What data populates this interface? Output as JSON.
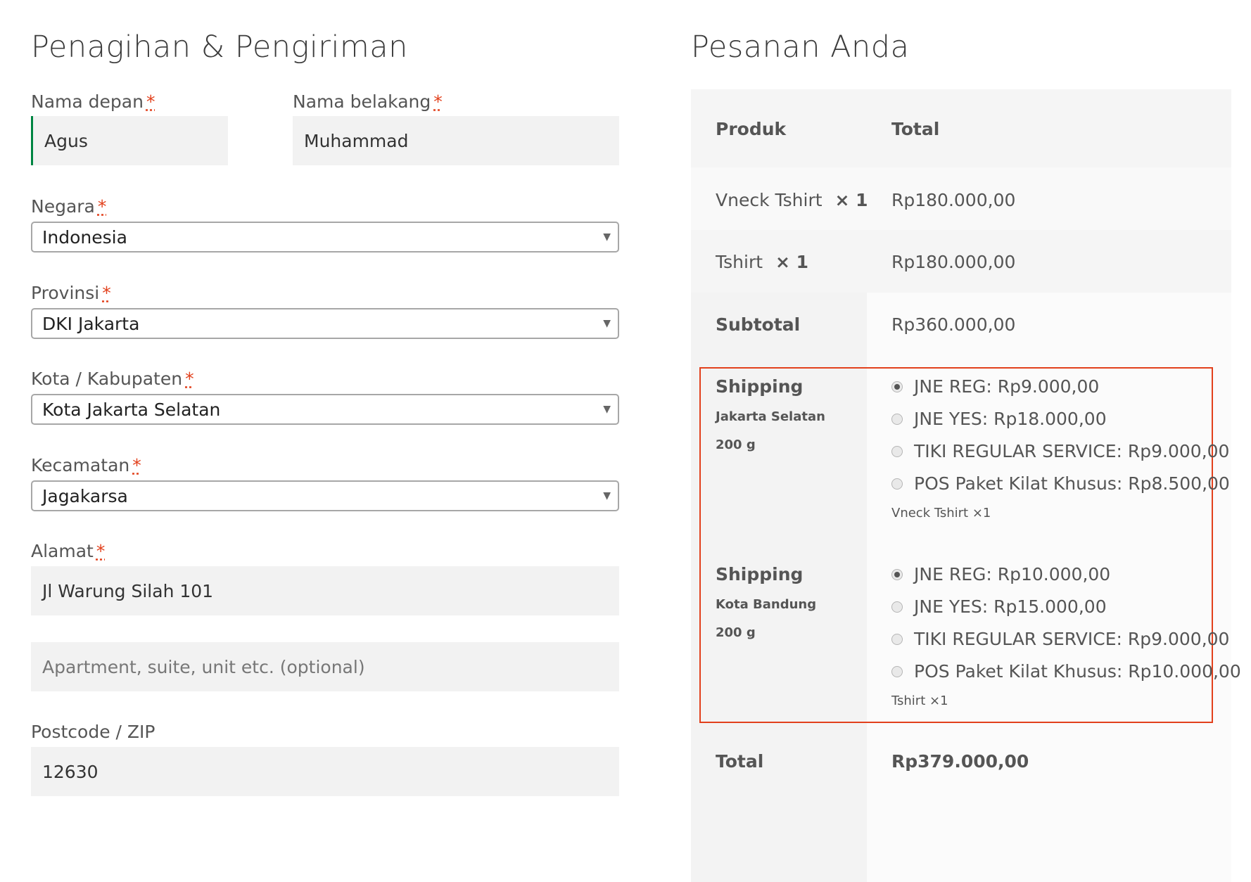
{
  "billing": {
    "title": "Penagihan & Pengiriman",
    "required_mark": "*",
    "first_name": {
      "label": "Nama depan",
      "value": "Agus"
    },
    "last_name": {
      "label": "Nama belakang",
      "value": "Muhammad"
    },
    "country": {
      "label": "Negara",
      "value": "Indonesia"
    },
    "province": {
      "label": "Provinsi",
      "value": "DKI Jakarta"
    },
    "city": {
      "label": "Kota / Kabupaten",
      "value": "Kota Jakarta Selatan"
    },
    "district": {
      "label": "Kecamatan",
      "value": "Jagakarsa"
    },
    "address": {
      "label": "Alamat",
      "value": "Jl Warung Silah 101",
      "placeholder2": "Apartment, suite, unit etc. (optional)"
    },
    "postcode": {
      "label": "Postcode / ZIP",
      "value": "12630"
    }
  },
  "order": {
    "title": "Pesanan Anda",
    "col_product": "Produk",
    "col_total": "Total",
    "items": [
      {
        "name": "Vneck Tshirt",
        "qty": "× 1",
        "total": "Rp180.000,00"
      },
      {
        "name": "Tshirt",
        "qty": "× 1",
        "total": "Rp180.000,00"
      }
    ],
    "subtotal_label": "Subtotal",
    "subtotal_value": "Rp360.000,00",
    "shipping": [
      {
        "label": "Shipping",
        "destination": "Jakarta Selatan",
        "weight": "200 g",
        "options": [
          {
            "text": "JNE REG: Rp9.000,00",
            "selected": true
          },
          {
            "text": "JNE YES: Rp18.000,00",
            "selected": false
          },
          {
            "text": "TIKI REGULAR SERVICE: Rp9.000,00",
            "selected": false
          },
          {
            "text": "POS Paket Kilat Khusus: Rp8.500,00",
            "selected": false
          }
        ],
        "items_note": "Vneck Tshirt ×1"
      },
      {
        "label": "Shipping",
        "destination": "Kota Bandung",
        "weight": "200 g",
        "options": [
          {
            "text": "JNE REG: Rp10.000,00",
            "selected": true
          },
          {
            "text": "JNE YES: Rp15.000,00",
            "selected": false
          },
          {
            "text": "TIKI REGULAR SERVICE: Rp9.000,00",
            "selected": false
          },
          {
            "text": "POS Paket Kilat Khusus: Rp10.000,00",
            "selected": false
          }
        ],
        "items_note": "Tshirt ×1"
      }
    ],
    "total_label": "Total",
    "total_value": "Rp379.000,00"
  },
  "colors": {
    "accent_border": "#008542",
    "highlight_box": "#e2401c",
    "field_bg": "#f2f2f2",
    "table_bg": "#f8f8f8"
  }
}
